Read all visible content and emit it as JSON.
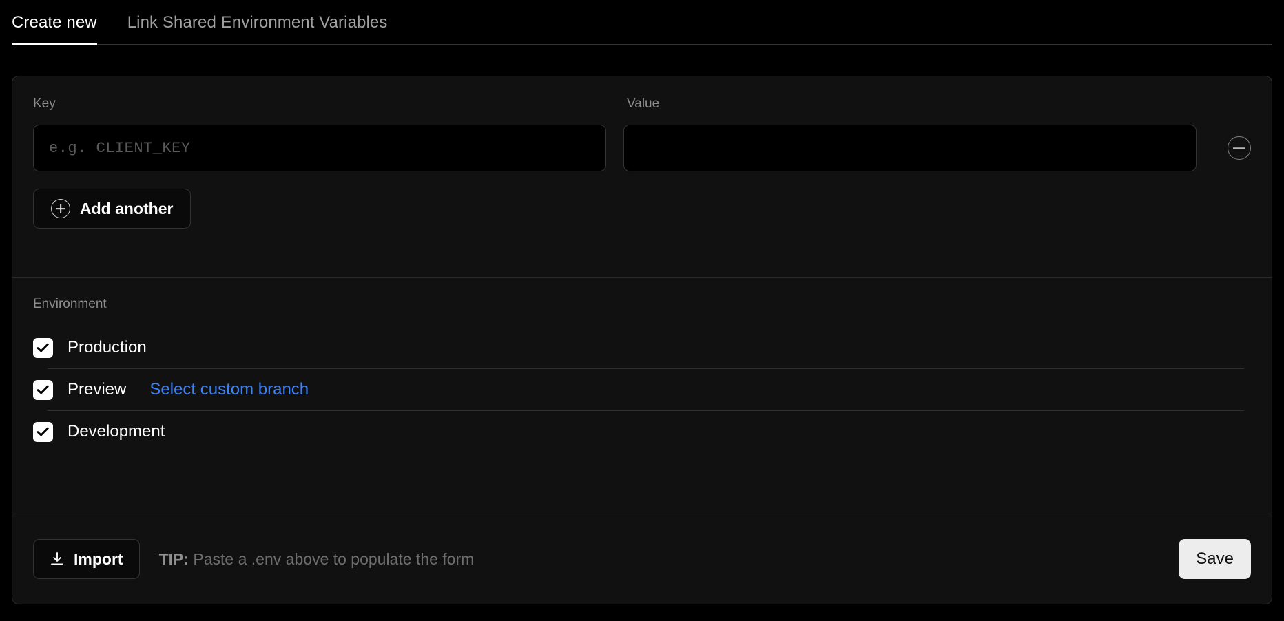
{
  "tabs": [
    {
      "label": "Create new",
      "active": true
    },
    {
      "label": "Link Shared Environment Variables",
      "active": false
    }
  ],
  "form": {
    "key_label": "Key",
    "value_label": "Value",
    "key_placeholder": "e.g. CLIENT_KEY",
    "key_value": "",
    "value_value": "",
    "value_placeholder": "",
    "remove_icon": "circle-minus-icon",
    "add_another_label": "Add another",
    "add_icon": "circle-plus-icon"
  },
  "environment": {
    "title": "Environment",
    "options": [
      {
        "label": "Production",
        "checked": true
      },
      {
        "label": "Preview",
        "checked": true,
        "link": "Select custom branch"
      },
      {
        "label": "Development",
        "checked": true
      }
    ]
  },
  "footer": {
    "import_label": "Import",
    "import_icon": "download-icon",
    "tip_prefix": "TIP:",
    "tip_text": "Paste a .env above to populate the form",
    "save_label": "Save"
  },
  "colors": {
    "page_background": "#000000",
    "card_background": "#111111",
    "border": "#2b2b2b",
    "link_blue": "#3b82f6",
    "muted_text": "#8d8d8d",
    "save_background": "#ededed"
  }
}
